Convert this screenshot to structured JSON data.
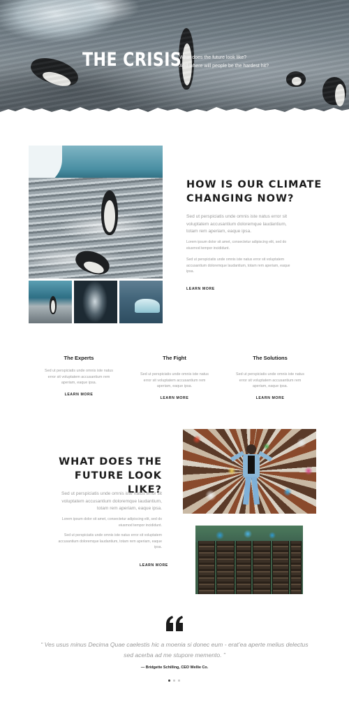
{
  "hero": {
    "title": "THE CRISIS",
    "subtitle_line1": "What does the future look like?",
    "subtitle_line2": "And where will people be the hardest hit?"
  },
  "climate_section": {
    "heading_line1": "HOW IS OUR CLIMATE",
    "heading_line2": "CHANGING NOW?",
    "paragraph1": "Sed ut perspiciatis unde omnis iste natus error sit voluptatem accusantium doloremque laudantium, totam rem aperiam, eaque ipsa.",
    "paragraph2": "Lorem ipsum dolor sit amet, consectetur adipiscing elit, sed do eiusmod tempor incididunt.",
    "paragraph3": "Sed ut perspiciatis unde omnis iste natus error sit voluptatem accusantium doloremque laudantium, totam rem aperiam, eaque ipsa.",
    "learn_more": "LEARN MORE"
  },
  "features": [
    {
      "title": "The Experts",
      "text": "Sed ut perspiciatis unde omnis iste natus error sit voluptatem accusantium rem aperiam, eaque ipsa.",
      "learn_more": "LEARN MORE"
    },
    {
      "title": "The Fight",
      "text": "Sed ut perspiciatis unde omnis iste natus error sit voluptatem accusantium rem aperiam, eaque ipsa.",
      "learn_more": "LEARN MORE"
    },
    {
      "title": "The Solutions",
      "text": "Sed ut perspiciatis unde omnis iste natus error sit voluptatem accusantium rem aperiam, eaque ipsa.",
      "learn_more": "LEARN MORE"
    }
  ],
  "future_section": {
    "heading_line1": "WHAT DOES THE",
    "heading_line2": "FUTURE LOOK LIKE?",
    "paragraph1": "Sed ut perspiciatis unde omnis iste natus error sit voluptatem accusantium doloremque laudantium, totam rem aperiam, eaque ipsa.",
    "paragraph2": "Lorem ipsum dolor sit amet, consectetur adipiscing elit, sed do eiusmod tempor incididunt.",
    "paragraph3": "Sed ut perspiciatis unde omnis iste natus error sit voluptatem accusantium doloremque laudantium, totam rem aperiam, eaque ipsa.",
    "learn_more": "LEARN MORE"
  },
  "testimonial": {
    "quote_line1": "“ Ves usus minus Decima Quae caelestis hic a moenia si donec eum - erat’ea aperte melius delectus",
    "quote_line2": "sed acerba ad me stupore memento. ”",
    "author": "— Bridgette Schilling, CEO Wellie Co.",
    "active_slide": 1,
    "slide_count": 3
  },
  "icons": {
    "quote": "quote-icon"
  },
  "colors": {
    "heading": "#1b1b1b",
    "body_text": "#9a9a9a",
    "background": "#ffffff"
  }
}
